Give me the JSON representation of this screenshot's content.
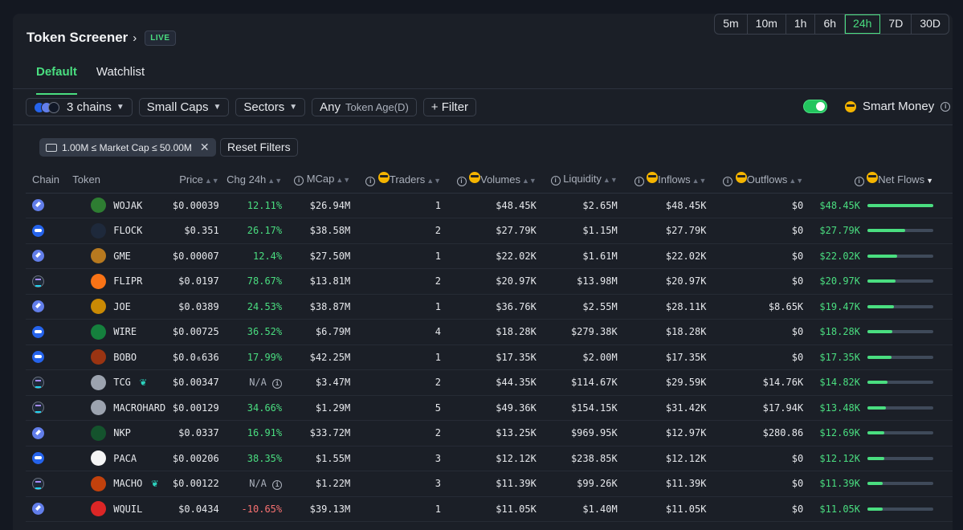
{
  "header": {
    "title": "Token Screener",
    "live_badge": "LIVE"
  },
  "timeframes": [
    {
      "label": "5m",
      "active": false
    },
    {
      "label": "10m",
      "active": false
    },
    {
      "label": "1h",
      "active": false
    },
    {
      "label": "6h",
      "active": false
    },
    {
      "label": "24h",
      "active": true
    },
    {
      "label": "7D",
      "active": false
    },
    {
      "label": "30D",
      "active": false
    }
  ],
  "tabs": [
    {
      "label": "Default",
      "active": true
    },
    {
      "label": "Watchlist",
      "active": false
    }
  ],
  "filters": {
    "chains": "3 chains",
    "caps": "Small Caps",
    "sectors": "Sectors",
    "age_value": "Any",
    "age_label": "Token Age(D)",
    "filter_button": "+ Filter",
    "smart_money": "Smart Money",
    "smart_money_enabled": true
  },
  "active_filter": {
    "label": "1.00M ≤ Market Cap ≤ 50.00M",
    "reset": "Reset Filters"
  },
  "columns": {
    "chain": "Chain",
    "token": "Token",
    "price": "Price",
    "chg": "Chg 24h",
    "mcap": "MCap",
    "traders": "Traders",
    "volumes": "Volumes",
    "liquidity": "Liquidity",
    "inflows": "Inflows",
    "outflows": "Outflows",
    "netflows": "Net Flows"
  },
  "colors": {
    "accent": "#4ade80",
    "negative": "#f87171",
    "panel": "#1b1f27"
  },
  "rows": [
    {
      "chain": "eth",
      "token": "WOJAK",
      "avatar": "#2e7d32",
      "price": "$0.00039",
      "chg": "12.11%",
      "chg_state": "pos",
      "mcap": "$26.94M",
      "traders": "1",
      "volumes": "$48.45K",
      "liquidity": "$2.65M",
      "inflows": "$48.45K",
      "outflows": "$0",
      "netflows": "$48.45K",
      "flow_fraction": 1.0,
      "leaf": false
    },
    {
      "chain": "base",
      "token": "FLOCK",
      "avatar": "#1e293b",
      "price": "$0.351",
      "chg": "26.17%",
      "chg_state": "pos",
      "mcap": "$38.58M",
      "traders": "2",
      "volumes": "$27.79K",
      "liquidity": "$1.15M",
      "inflows": "$27.79K",
      "outflows": "$0",
      "netflows": "$27.79K",
      "flow_fraction": 0.57,
      "leaf": false
    },
    {
      "chain": "eth",
      "token": "GME",
      "avatar": "#b7791f",
      "price": "$0.00007",
      "chg": "12.4%",
      "chg_state": "pos",
      "mcap": "$27.50M",
      "traders": "1",
      "volumes": "$22.02K",
      "liquidity": "$1.61M",
      "inflows": "$22.02K",
      "outflows": "$0",
      "netflows": "$22.02K",
      "flow_fraction": 0.45,
      "leaf": false
    },
    {
      "chain": "sol",
      "token": "FLIPR",
      "avatar": "#f97316",
      "price": "$0.0197",
      "chg": "78.67%",
      "chg_state": "pos",
      "mcap": "$13.81M",
      "traders": "2",
      "volumes": "$20.97K",
      "liquidity": "$13.98M",
      "inflows": "$20.97K",
      "outflows": "$0",
      "netflows": "$20.97K",
      "flow_fraction": 0.43,
      "leaf": false
    },
    {
      "chain": "eth",
      "token": "JOE",
      "avatar": "#ca8a04",
      "price": "$0.0389",
      "chg": "24.53%",
      "chg_state": "pos",
      "mcap": "$38.87M",
      "traders": "1",
      "volumes": "$36.76K",
      "liquidity": "$2.55M",
      "inflows": "$28.11K",
      "outflows": "$8.65K",
      "netflows": "$19.47K",
      "flow_fraction": 0.4,
      "leaf": false
    },
    {
      "chain": "base",
      "token": "WIRE",
      "avatar": "#15803d",
      "price": "$0.00725",
      "chg": "36.52%",
      "chg_state": "pos",
      "mcap": "$6.79M",
      "traders": "4",
      "volumes": "$18.28K",
      "liquidity": "$279.38K",
      "inflows": "$18.28K",
      "outflows": "$0",
      "netflows": "$18.28K",
      "flow_fraction": 0.38,
      "leaf": false
    },
    {
      "chain": "base",
      "token": "BOBO",
      "avatar": "#9a3412",
      "price": "$0.0₆636",
      "chg": "17.99%",
      "chg_state": "pos",
      "mcap": "$42.25M",
      "traders": "1",
      "volumes": "$17.35K",
      "liquidity": "$2.00M",
      "inflows": "$17.35K",
      "outflows": "$0",
      "netflows": "$17.35K",
      "flow_fraction": 0.36,
      "leaf": false
    },
    {
      "chain": "sol",
      "token": "TCG",
      "avatar": "#9ca3af",
      "price": "$0.00347",
      "chg": "N/A",
      "chg_state": "na",
      "mcap": "$3.47M",
      "traders": "2",
      "volumes": "$44.35K",
      "liquidity": "$114.67K",
      "inflows": "$29.59K",
      "outflows": "$14.76K",
      "netflows": "$14.82K",
      "flow_fraction": 0.31,
      "leaf": true
    },
    {
      "chain": "sol",
      "token": "MACROHARD",
      "avatar": "#9ca3af",
      "price": "$0.00129",
      "chg": "34.66%",
      "chg_state": "pos",
      "mcap": "$1.29M",
      "traders": "5",
      "volumes": "$49.36K",
      "liquidity": "$154.15K",
      "inflows": "$31.42K",
      "outflows": "$17.94K",
      "netflows": "$13.48K",
      "flow_fraction": 0.28,
      "leaf": false
    },
    {
      "chain": "eth",
      "token": "NKP",
      "avatar": "#14532d",
      "price": "$0.0337",
      "chg": "16.91%",
      "chg_state": "pos",
      "mcap": "$33.72M",
      "traders": "2",
      "volumes": "$13.25K",
      "liquidity": "$969.95K",
      "inflows": "$12.97K",
      "outflows": "$280.86",
      "netflows": "$12.69K",
      "flow_fraction": 0.26,
      "leaf": false
    },
    {
      "chain": "base",
      "token": "PACA",
      "avatar": "#f5f5f5",
      "price": "$0.00206",
      "chg": "38.35%",
      "chg_state": "pos",
      "mcap": "$1.55M",
      "traders": "3",
      "volumes": "$12.12K",
      "liquidity": "$238.85K",
      "inflows": "$12.12K",
      "outflows": "$0",
      "netflows": "$12.12K",
      "flow_fraction": 0.25,
      "leaf": false
    },
    {
      "chain": "sol",
      "token": "MACHO",
      "avatar": "#c2410c",
      "price": "$0.00122",
      "chg": "N/A",
      "chg_state": "na",
      "mcap": "$1.22M",
      "traders": "3",
      "volumes": "$11.39K",
      "liquidity": "$99.26K",
      "inflows": "$11.39K",
      "outflows": "$0",
      "netflows": "$11.39K",
      "flow_fraction": 0.23,
      "leaf": true
    },
    {
      "chain": "eth",
      "token": "WQUIL",
      "avatar": "#dc2626",
      "price": "$0.0434",
      "chg": "-10.65%",
      "chg_state": "neg",
      "mcap": "$39.13M",
      "traders": "1",
      "volumes": "$11.05K",
      "liquidity": "$1.40M",
      "inflows": "$11.05K",
      "outflows": "$0",
      "netflows": "$11.05K",
      "flow_fraction": 0.23,
      "leaf": false
    }
  ]
}
